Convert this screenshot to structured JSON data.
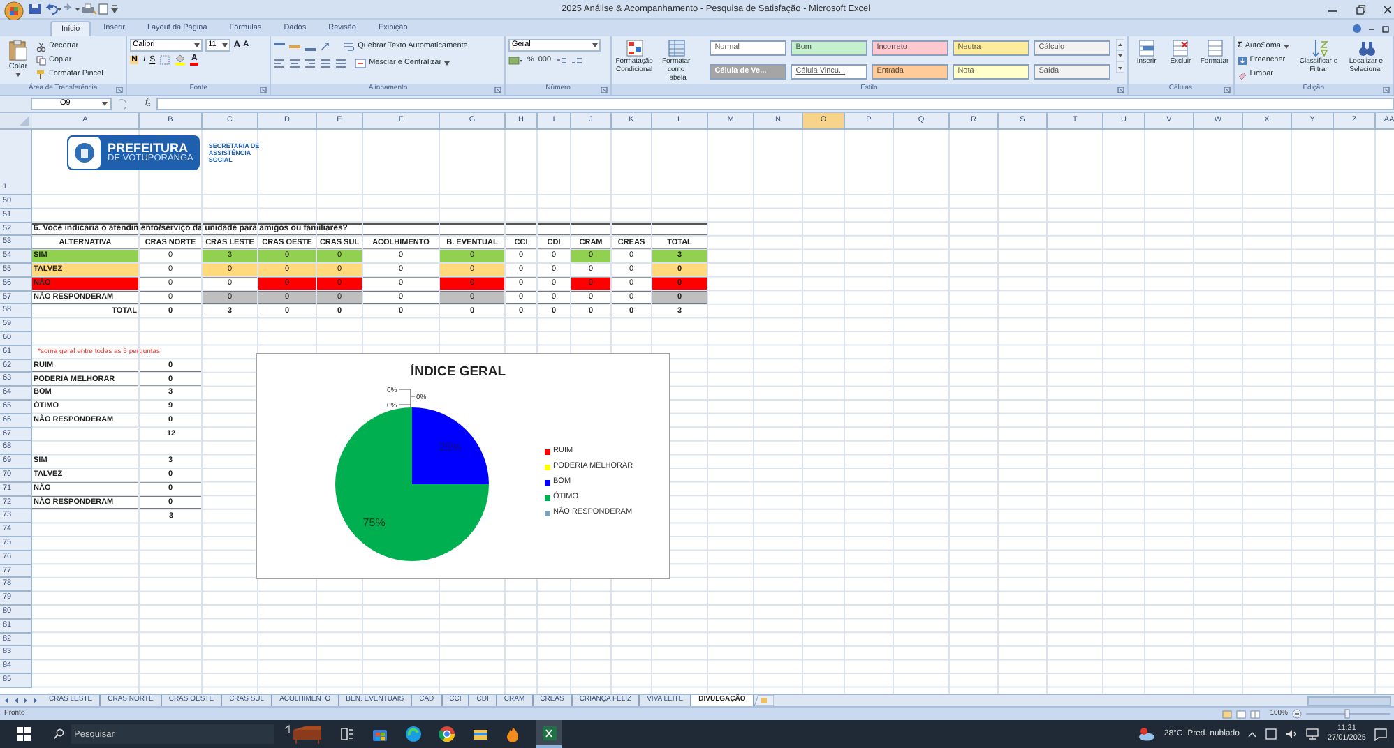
{
  "window": {
    "title": "2025 Análise & Acompanhamento - Pesquisa de Satisfação - Microsoft Excel"
  },
  "ribbon": {
    "tabs": [
      {
        "label": "Início",
        "selected": true
      },
      {
        "label": "Inserir",
        "selected": false
      },
      {
        "label": "Layout da Página",
        "selected": false
      },
      {
        "label": "Fórmulas",
        "selected": false
      },
      {
        "label": "Dados",
        "selected": false
      },
      {
        "label": "Revisão",
        "selected": false
      },
      {
        "label": "Exibição",
        "selected": false
      }
    ],
    "clipboard": {
      "label": "Área de Transferência",
      "paste": "Colar",
      "cut": "Recortar",
      "copy": "Copiar",
      "format_painter": "Formatar Pincel"
    },
    "font": {
      "label": "Fonte",
      "family": "Calibri",
      "size": "11",
      "grow": "A",
      "shrink": "A",
      "bold": "N",
      "italic": "I",
      "underline": "S",
      "font_color": "A"
    },
    "alignment": {
      "label": "Alinhamento",
      "wrap": "Quebrar Texto Automaticamente",
      "merge": "Mesclar e Centralizar"
    },
    "number": {
      "label": "Número",
      "format": "Geral",
      "percent": "%",
      "thousands": "000"
    },
    "styles": {
      "label": "Estilo",
      "conditional": "Formatação Condicional",
      "as_table": "Formatar como Tabela",
      "gallery": [
        {
          "label": "Normal",
          "color": "#ffffff"
        },
        {
          "label": "Bom",
          "color": "#c6efce"
        },
        {
          "label": "Incorreto",
          "color": "#ffc7ce"
        },
        {
          "label": "Neutra",
          "color": "#ffeb9c"
        },
        {
          "label": "Cálculo",
          "color": "#f2f2f2"
        },
        {
          "label": "Célula de Ve...",
          "color": "#a5a5a5"
        },
        {
          "label": "Célula Vincu...",
          "color": "#ffffff"
        },
        {
          "label": "Entrada",
          "color": "#ffcc99"
        },
        {
          "label": "Nota",
          "color": "#ffffcc"
        },
        {
          "label": "Saída",
          "color": "#f2f2f2"
        }
      ]
    },
    "cells": {
      "label": "Células",
      "insert": "Inserir",
      "delete": "Excluir",
      "format": "Formatar"
    },
    "editing": {
      "label": "Edição",
      "sigma": "Σ",
      "autosum": "AutoSoma",
      "fill": "Preencher",
      "clear": "Limpar",
      "sort": "Classificar e Filtrar",
      "find": "Localizar e Selecionar"
    }
  },
  "formula_bar": {
    "name_box": "O9",
    "function_button": "f$_{x}$"
  },
  "sheet": {
    "columns": [
      {
        "label": "A",
        "selected": false
      },
      {
        "label": "B",
        "selected": false
      },
      {
        "label": "C",
        "selected": false
      },
      {
        "label": "D",
        "selected": false
      },
      {
        "label": "E",
        "selected": false
      },
      {
        "label": "F",
        "selected": false
      },
      {
        "label": "G",
        "selected": false
      },
      {
        "label": "H",
        "selected": false
      },
      {
        "label": "I",
        "selected": false
      },
      {
        "label": "J",
        "selected": false
      },
      {
        "label": "K",
        "selected": false
      },
      {
        "label": "L",
        "selected": false
      },
      {
        "label": "M",
        "selected": false
      },
      {
        "label": "N",
        "selected": false
      },
      {
        "label": "O",
        "selected": true
      },
      {
        "label": "P",
        "selected": false
      },
      {
        "label": "Q",
        "selected": false
      },
      {
        "label": "R",
        "selected": false
      },
      {
        "label": "S",
        "selected": false
      },
      {
        "label": "T",
        "selected": false
      },
      {
        "label": "U",
        "selected": false
      },
      {
        "label": "V",
        "selected": false
      },
      {
        "label": "W",
        "selected": false
      },
      {
        "label": "X",
        "selected": false
      },
      {
        "label": "Y",
        "selected": false
      },
      {
        "label": "Z",
        "selected": false
      },
      {
        "label": "AA",
        "selected": false
      }
    ],
    "row_numbers": [
      "1",
      "50",
      "51",
      "52",
      "53",
      "54",
      "55",
      "56",
      "57",
      "58",
      "59",
      "60",
      "61",
      "62",
      "63",
      "64",
      "65",
      "66",
      "67",
      "68",
      "69",
      "70",
      "71",
      "72",
      "73",
      "74",
      "75",
      "76",
      "77",
      "78",
      "79",
      "80",
      "81",
      "82",
      "83",
      "84",
      "85"
    ],
    "logo": {
      "title": "PREFEITURA",
      "subtitle": "DE VOTUPORANGA",
      "department": "SECRETARIA DE ASSISTÊNCIA SOCIAL"
    },
    "table": {
      "title": "6. Você indicaria o atendimento/serviço da unidade para amigos ou familiares?",
      "headers": [
        "ALTERNATIVA",
        "CRAS NORTE",
        "CRAS LESTE",
        "CRAS OESTE",
        "CRAS SUL",
        "ACOLHIMENTO",
        "B. EVENTUAL",
        "CCI",
        "CDI",
        "CRAM",
        "CREAS",
        "TOTAL"
      ],
      "rows": [
        {
          "label": "SIM",
          "color": "#92d050",
          "label_highlighted": true,
          "cells": [
            {
              "value": "0",
              "highlighted": false
            },
            {
              "value": "3",
              "highlighted": true
            },
            {
              "value": "0",
              "highlighted": true
            },
            {
              "value": "0",
              "highlighted": true
            },
            {
              "value": "0",
              "highlighted": false
            },
            {
              "value": "0",
              "highlighted": true
            },
            {
              "value": "0",
              "highlighted": false
            },
            {
              "value": "0",
              "highlighted": false
            },
            {
              "value": "0",
              "highlighted": true
            },
            {
              "value": "0",
              "highlighted": false
            },
            {
              "value": "3",
              "highlighted": true
            }
          ]
        },
        {
          "label": "TALVEZ",
          "color": "#ffd97a",
          "label_highlighted": true,
          "cells": [
            {
              "value": "0",
              "highlighted": false
            },
            {
              "value": "0",
              "highlighted": true
            },
            {
              "value": "0",
              "highlighted": true
            },
            {
              "value": "0",
              "highlighted": true
            },
            {
              "value": "0",
              "highlighted": false
            },
            {
              "value": "0",
              "highlighted": true
            },
            {
              "value": "0",
              "highlighted": false
            },
            {
              "value": "0",
              "highlighted": false
            },
            {
              "value": "0",
              "highlighted": false
            },
            {
              "value": "0",
              "highlighted": false
            },
            {
              "value": "0",
              "highlighted": true
            }
          ]
        },
        {
          "label": "NÃO",
          "color": "#ff0000",
          "label_highlighted": true,
          "cells": [
            {
              "value": "0",
              "highlighted": false
            },
            {
              "value": "0",
              "highlighted": false
            },
            {
              "value": "0",
              "highlighted": true
            },
            {
              "value": "0",
              "highlighted": true
            },
            {
              "value": "0",
              "highlighted": false
            },
            {
              "value": "0",
              "highlighted": true
            },
            {
              "value": "0",
              "highlighted": false
            },
            {
              "value": "0",
              "highlighted": false
            },
            {
              "value": "0",
              "highlighted": true
            },
            {
              "value": "0",
              "highlighted": false
            },
            {
              "value": "0",
              "highlighted": true
            }
          ]
        },
        {
          "label": "NÃO RESPONDERAM",
          "color": "#bfbfbf",
          "label_highlighted": false,
          "cells": [
            {
              "value": "0",
              "highlighted": false
            },
            {
              "value": "0",
              "highlighted": true
            },
            {
              "value": "0",
              "highlighted": true
            },
            {
              "value": "0",
              "highlighted": true
            },
            {
              "value": "0",
              "highlighted": false
            },
            {
              "value": "0",
              "highlighted": true
            },
            {
              "value": "0",
              "highlighted": false
            },
            {
              "value": "0",
              "highlighted": false
            },
            {
              "value": "0",
              "highlighted": false
            },
            {
              "value": "0",
              "highlighted": false
            },
            {
              "value": "0",
              "highlighted": true
            }
          ]
        }
      ],
      "total": {
        "label": "TOTAL",
        "values": [
          "0",
          "3",
          "0",
          "0",
          "0",
          "0",
          "0",
          "0",
          "0",
          "0",
          "3"
        ]
      }
    },
    "note": "*soma geral entre todas as 5 perguntas",
    "summary_blocks": [
      {
        "rows": [
          {
            "label": "RUIM",
            "value": "0"
          },
          {
            "label": "PODERIA MELHORAR",
            "value": "0"
          },
          {
            "label": "BOM",
            "value": "3"
          },
          {
            "label": "ÓTIMO",
            "value": "9"
          },
          {
            "label": "NÃO RESPONDERAM",
            "value": "0"
          }
        ],
        "total": "12"
      },
      {
        "rows": [
          {
            "label": "SIM",
            "value": "3"
          },
          {
            "label": "TALVEZ",
            "value": "0"
          },
          {
            "label": "NÃO",
            "value": "0"
          },
          {
            "label": "NÃO RESPONDERAM",
            "value": "0"
          }
        ],
        "total": "3"
      }
    ],
    "chart": {
      "slices": [
        {
          "color": "#ff0000"
        },
        {
          "color": "#ffff00"
        },
        {
          "color": "#0000ff"
        },
        {
          "color": "#00b050"
        },
        {
          "color": "#7f9fbf"
        }
      ],
      "chart_data": {
        "type": "pie",
        "title": "ÍNDICE GERAL",
        "categories": [
          "RUIM",
          "PODERIA MELHORAR",
          "BOM",
          "ÓTIMO",
          "NÃO RESPONDERAM"
        ],
        "values": [
          0,
          0,
          25,
          75,
          0
        ],
        "value_labels": [
          "0%",
          "0%",
          "25%",
          "75%",
          "0%"
        ],
        "legend": "right"
      }
    }
  },
  "sheet_tabs": [
    {
      "label": "CRAS LESTE",
      "selected": false
    },
    {
      "label": "CRAS NORTE",
      "selected": false
    },
    {
      "label": "CRAS OESTE",
      "selected": false
    },
    {
      "label": "CRAS SUL",
      "selected": false
    },
    {
      "label": "ACOLHIMENTO",
      "selected": false
    },
    {
      "label": "BEN. EVENTUAIS",
      "selected": false
    },
    {
      "label": "CAD",
      "selected": false
    },
    {
      "label": "CCI",
      "selected": false
    },
    {
      "label": "CDI",
      "selected": false
    },
    {
      "label": "CRAM",
      "selected": false
    },
    {
      "label": "CREAS",
      "selected": false
    },
    {
      "label": "CRIANÇA FELIZ",
      "selected": false
    },
    {
      "label": "VIVA LEITE",
      "selected": false
    },
    {
      "label": "DIVULGAÇÃO",
      "selected": true
    }
  ],
  "status_bar": {
    "status": "Pronto",
    "zoom": "100%"
  },
  "taskbar": {
    "search_placeholder": "Pesquisar",
    "weather": "28°C  Pred. nublado",
    "time": "11:21",
    "date": "27/01/2025"
  }
}
